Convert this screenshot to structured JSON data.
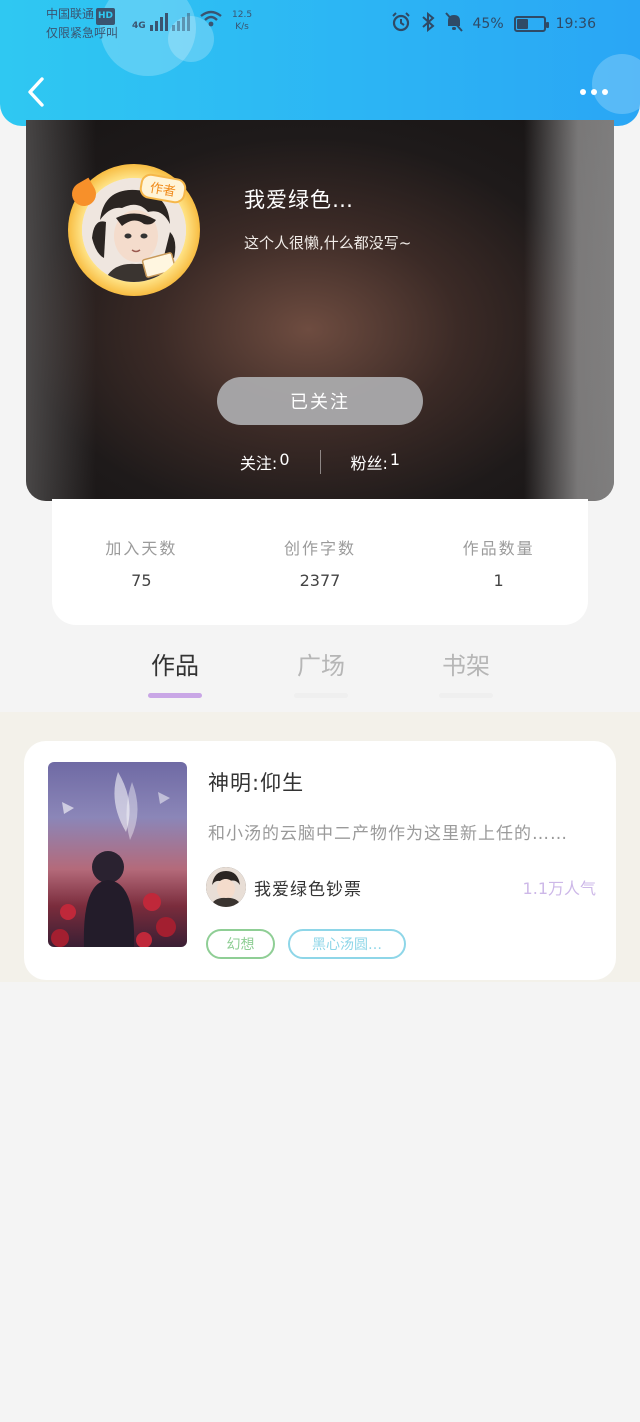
{
  "status_bar": {
    "carrier": "中国联通",
    "hd": "HD",
    "emergency": "仅限紧急呼叫",
    "network": "4G",
    "speed_value": "12.5",
    "speed_unit": "K/s",
    "battery": "45%",
    "battery_level": 0.45,
    "time": "19:36"
  },
  "profile": {
    "author_badge": "作者",
    "username": "我爱绿色…",
    "bio": "这个人很懒,什么都没写~",
    "follow_button": "已关注",
    "following_label": "关注:",
    "following_count": "0",
    "fans_label": "粉丝:",
    "fans_count": "1"
  },
  "stats": [
    {
      "label": "加入天数",
      "value": "75"
    },
    {
      "label": "创作字数",
      "value": "2377"
    },
    {
      "label": "作品数量",
      "value": "1"
    }
  ],
  "tabs": [
    {
      "label": "作品",
      "active": true
    },
    {
      "label": "广场",
      "active": false
    },
    {
      "label": "书架",
      "active": false
    }
  ],
  "work": {
    "title": "神明:仰生",
    "description": "和小汤的云脑中二产物作为这里新上任的……",
    "author": "我爱绿色钞票",
    "popularity": "1.1万人气",
    "tags": [
      "幻想",
      "黑心汤圆…"
    ]
  },
  "colors": {
    "header_start": "#2fc8f2",
    "header_end": "#2aa6f5",
    "tab_indicator": "#c9a6e6",
    "popularity": "#cdb8e8",
    "tag_green": "#8fce95",
    "tag_blue": "#8ed6e8"
  }
}
